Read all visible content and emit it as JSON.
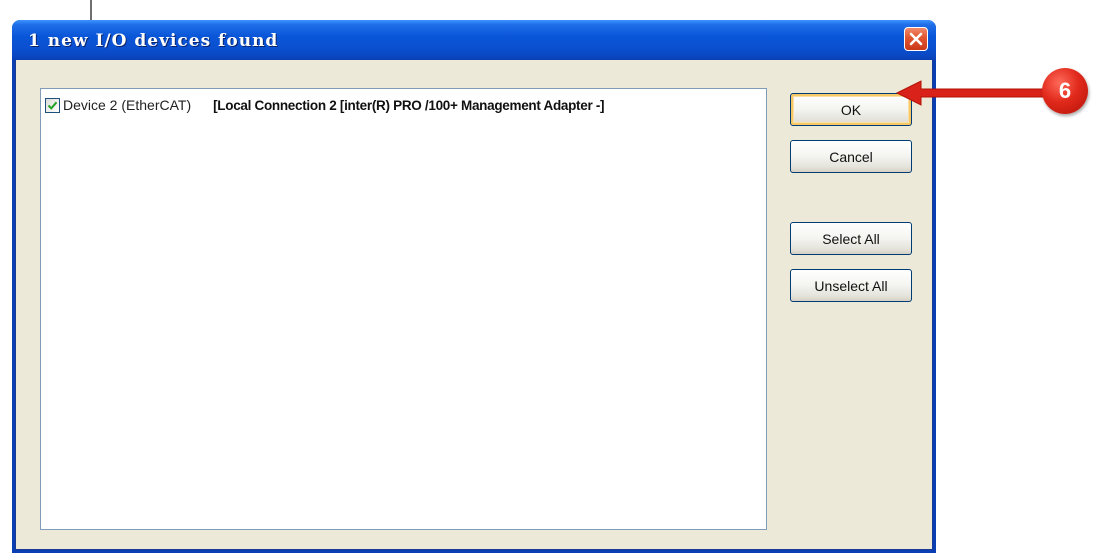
{
  "dialog": {
    "title": "1 new I/O devices found",
    "close_icon": "close-icon"
  },
  "device_list": {
    "items": [
      {
        "checked": true,
        "name": "Device 2 (EtherCAT)",
        "detail": "[Local Connection 2 [inter(R) PRO /100+ Management Adapter -]"
      }
    ]
  },
  "buttons": {
    "ok": "OK",
    "cancel": "Cancel",
    "select_all": "Select All",
    "unselect_all": "Unselect All"
  },
  "annotation": {
    "step_number": "6",
    "color": "#e12a1c"
  },
  "colors": {
    "title_bar": "#0a56d8",
    "dialog_bg": "#ece9d8",
    "close_button": "#e2552f",
    "ok_focus": "#f6c867"
  }
}
